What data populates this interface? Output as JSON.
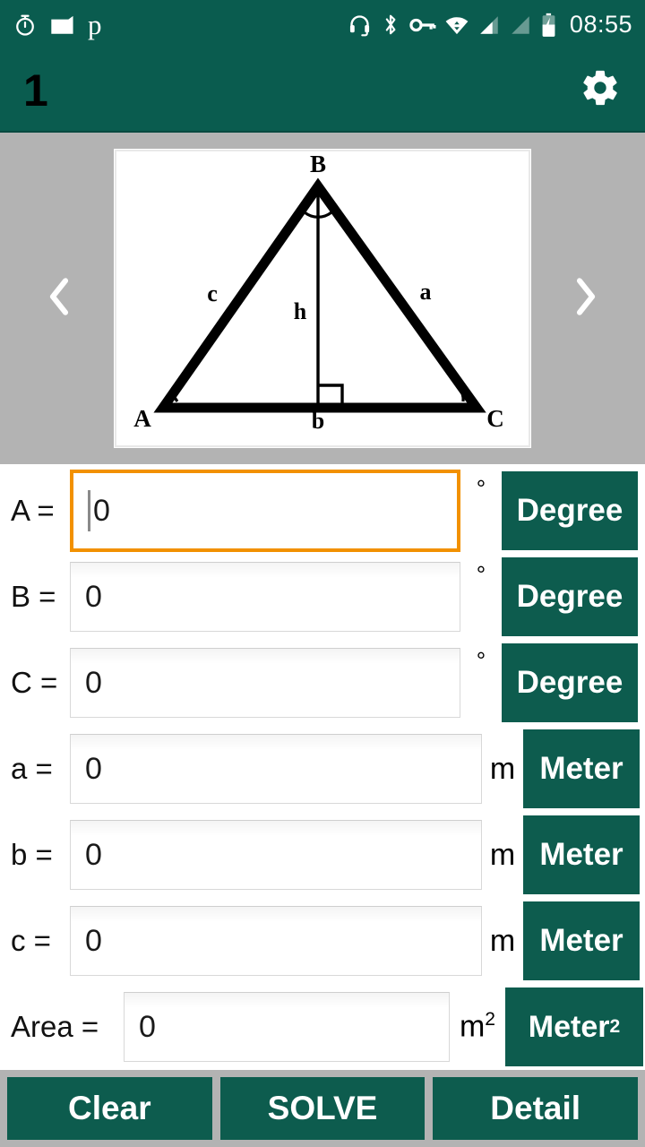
{
  "status_bar": {
    "time": "08:55",
    "left_icons": [
      {
        "name": "alarm-timer-icon",
        "glyph": "timer"
      },
      {
        "name": "sd-card-icon",
        "glyph": "card"
      },
      {
        "name": "letter-p-icon",
        "glyph": "p"
      }
    ],
    "right_icons": [
      {
        "name": "headset-icon"
      },
      {
        "name": "bluetooth-icon"
      },
      {
        "name": "vpn-key-icon"
      },
      {
        "name": "wifi-icon"
      },
      {
        "name": "signal-sim1-icon"
      },
      {
        "name": "signal-sim2-icon"
      },
      {
        "name": "battery-charging-icon"
      }
    ]
  },
  "app_bar": {
    "title": "1",
    "settings_label": "Settings"
  },
  "carousel": {
    "prev_label": "‹",
    "next_label": "›",
    "diagram": {
      "vertices": [
        "A",
        "B",
        "C"
      ],
      "sides": [
        "a",
        "b",
        "c"
      ],
      "height_label": "h"
    }
  },
  "form": {
    "rows": [
      {
        "label": "A =",
        "value": "0",
        "unit_symbol": "°",
        "unit_button": "Degree",
        "focused": true
      },
      {
        "label": "B =",
        "value": "0",
        "unit_symbol": "°",
        "unit_button": "Degree",
        "focused": false
      },
      {
        "label": "C =",
        "value": "0",
        "unit_symbol": "°",
        "unit_button": "Degree",
        "focused": false
      },
      {
        "label": "a =",
        "value": "0",
        "unit_symbol": "m",
        "unit_button": "Meter",
        "focused": false
      },
      {
        "label": "b =",
        "value": "0",
        "unit_symbol": "m",
        "unit_button": "Meter",
        "focused": false
      },
      {
        "label": "c =",
        "value": "0",
        "unit_symbol": "m",
        "unit_button": "Meter",
        "focused": false
      },
      {
        "label": "Area =",
        "value": "0",
        "unit_symbol": "m2",
        "unit_button": "Meter2",
        "focused": false
      }
    ],
    "m2_base": "m",
    "m2_sup": "2",
    "meter2_base": "Meter",
    "meter2_sup": "2"
  },
  "bottom_bar": {
    "clear_label": "Clear",
    "solve_label": "SOLVE",
    "detail_label": "Detail"
  },
  "colors": {
    "primary_teal": "#0a5c4f",
    "button_teal": "#0d5c4e",
    "focus_orange": "#f29100",
    "carousel_gray": "#b3b3b3"
  }
}
